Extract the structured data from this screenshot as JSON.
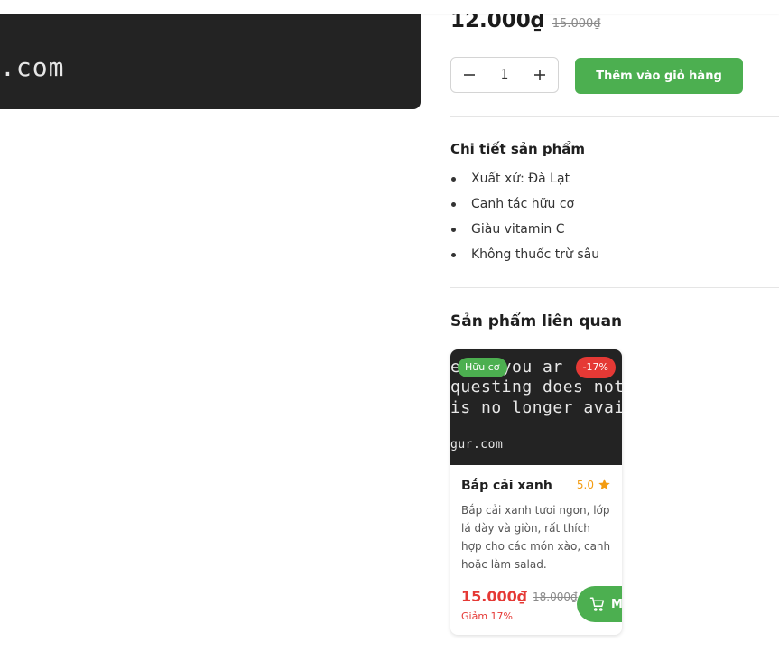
{
  "main_image": {
    "visible_text": ".com"
  },
  "product": {
    "price": "12.000₫",
    "old_price": "15.000₫",
    "quantity": "1",
    "add_to_cart_label": "Thêm vào giỏ hàng"
  },
  "details": {
    "title": "Chi tiết sản phẩm",
    "items": [
      "Xuất xứ: Đà Lạt",
      "Canh tác hữu cơ",
      "Giàu vitamin C",
      "Không thuốc trừ sâu"
    ]
  },
  "related": {
    "title": "Sản phẩm liên quan",
    "card": {
      "image_lines": [
        "e   ge you ar",
        "questing does not exi",
        "is no longer availabl",
        "gur.com"
      ],
      "badge_organic": "Hữu cơ",
      "badge_discount": "-17%",
      "name": "Bắp cải xanh",
      "rating": "5.0",
      "description": "Bắp cải xanh tươi ngon, lớp lá dày và giòn, rất thích hợp cho các món xào, canh hoặc làm salad.",
      "price": "15.000₫",
      "old_price": "18.000₫",
      "discount_text": "Giảm 17%",
      "cart_button_label": "M"
    }
  },
  "colors": {
    "accent_green": "#4caf50",
    "sale_red": "#e53935",
    "star_orange": "#f39c12",
    "image_bg": "#232323"
  },
  "icons": [
    "minus-icon",
    "plus-icon",
    "star-icon",
    "cart-icon"
  ]
}
